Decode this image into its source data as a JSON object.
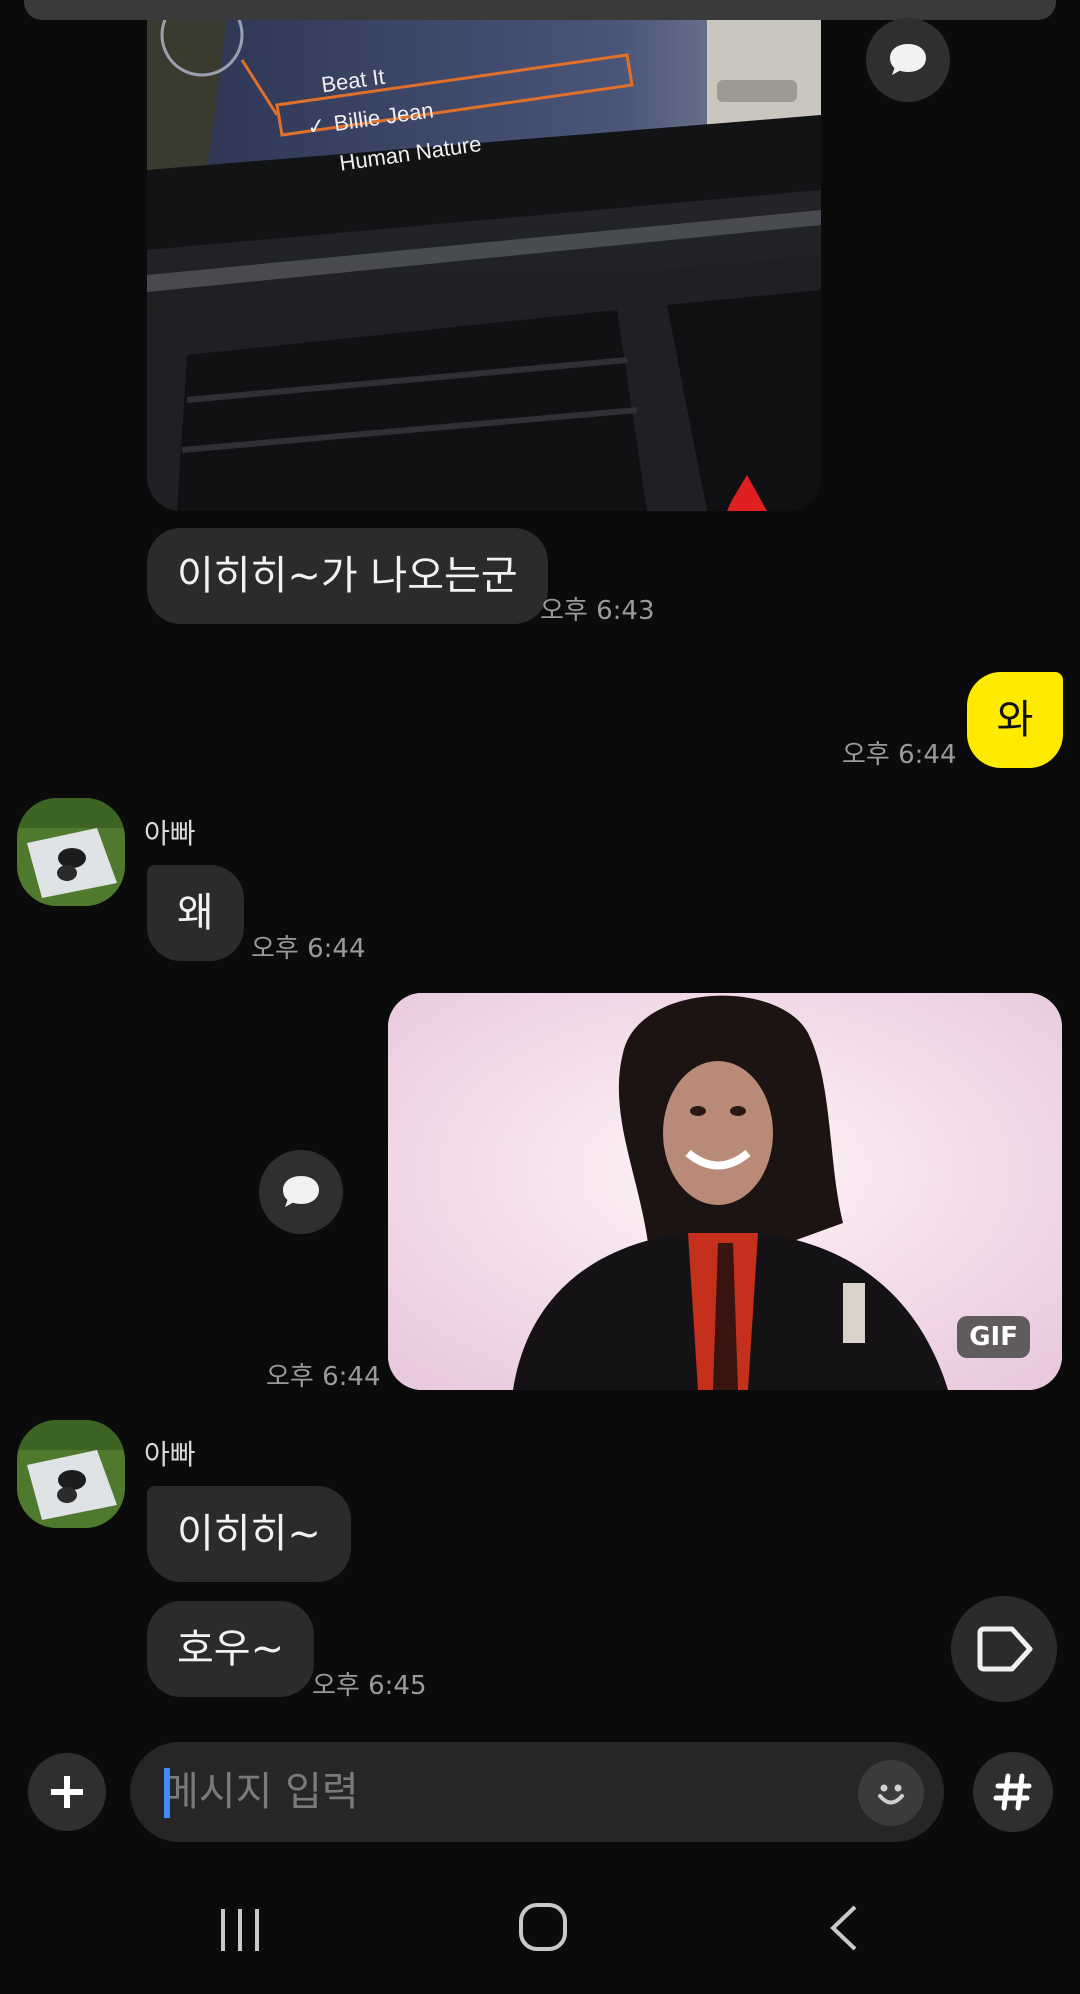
{
  "colors": {
    "background": "#0b0b0b",
    "incoming_bubble": "#2b2b2b",
    "outgoing_bubble": "#ffeb00",
    "time_text": "#9a9a9a"
  },
  "photo_message": {
    "menu_items": [
      "Beat It",
      "Billie Jean",
      "Human Nature"
    ],
    "selected_item": "Billie Jean",
    "check_mark": "✓"
  },
  "messages": [
    {
      "id": "m1",
      "direction": "incoming",
      "text": "이히히~가 나오는군",
      "time": "오후 6:43"
    },
    {
      "id": "m2",
      "direction": "outgoing",
      "text": "와",
      "time": "오후 6:44"
    },
    {
      "id": "m3",
      "direction": "incoming",
      "sender": "아빠",
      "text": "왜",
      "time": "오후 6:44"
    },
    {
      "id": "m4",
      "direction": "outgoing",
      "type": "gif",
      "badge": "GIF",
      "time": "오후 6:44"
    },
    {
      "id": "m5",
      "direction": "incoming",
      "sender": "아빠",
      "text": "이히히~"
    },
    {
      "id": "m6",
      "direction": "incoming",
      "text": "호우~",
      "time": "오후 6:45"
    }
  ],
  "composer": {
    "placeholder": "메시지 입력",
    "icons": [
      "plus-icon",
      "emoji-icon",
      "hashtag-icon"
    ]
  },
  "side_actions": {
    "comment_icon": "speech-bubble-icon",
    "tag_icon": "tag-icon"
  },
  "nav": [
    "recents-icon",
    "home-icon",
    "back-icon"
  ]
}
